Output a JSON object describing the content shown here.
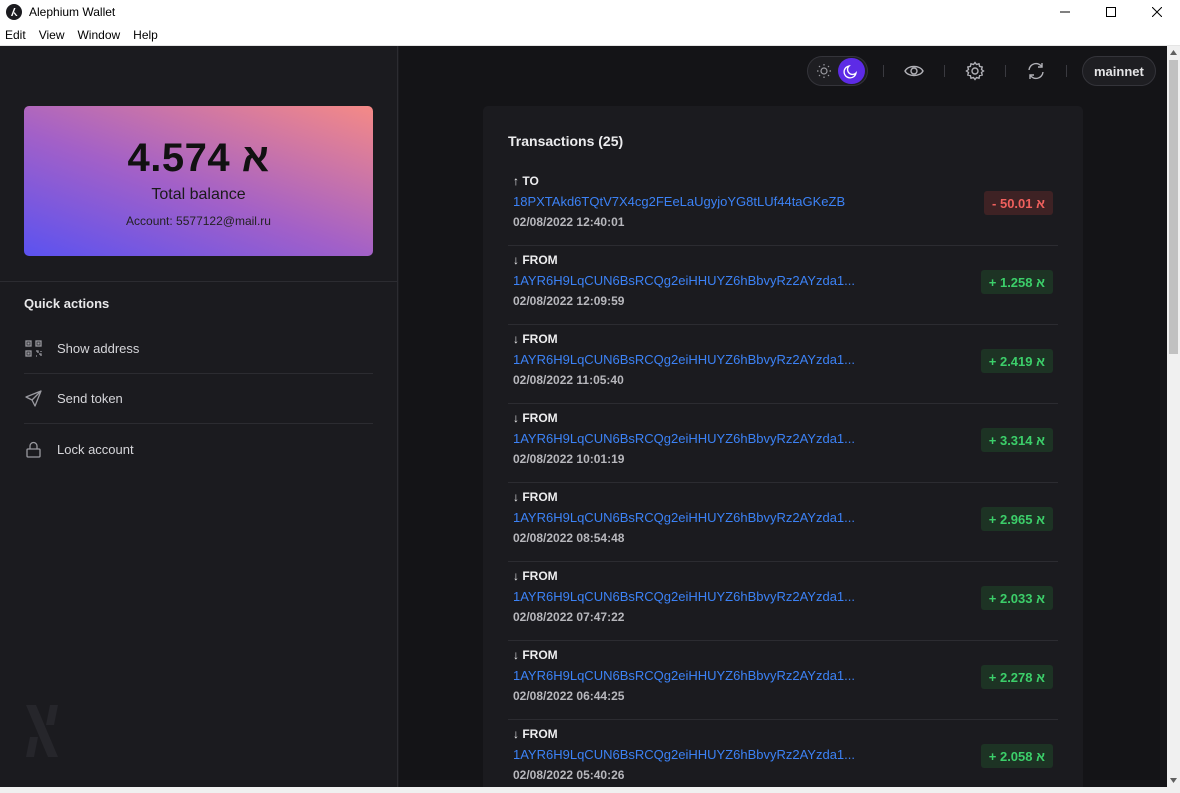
{
  "window": {
    "title": "Alephium Wallet"
  },
  "menu": [
    {
      "label": "Edit"
    },
    {
      "label": "View"
    },
    {
      "label": "Window"
    },
    {
      "label": "Help"
    }
  ],
  "balance": {
    "value": "4.574 א",
    "label": "Total balance",
    "account": "Account: 5577122@mail.ru"
  },
  "quick_actions": {
    "title": "Quick actions",
    "items": [
      {
        "label": "Show address",
        "icon": "qr-code-icon"
      },
      {
        "label": "Send token",
        "icon": "send-icon"
      },
      {
        "label": "Lock account",
        "icon": "lock-icon"
      }
    ]
  },
  "top_controls": {
    "theme_options": [
      "sun-icon",
      "moon-icon"
    ],
    "active_theme": "dark",
    "network": "mainnet"
  },
  "transactions": {
    "title": "Transactions (25)",
    "items": [
      {
        "direction": "↑ TO",
        "address": "18PXTAkd6TQtV7X4cg2FEeLaUgyjoYG8tLUf44taGKeZB",
        "date": "02/08/2022 12:40:01",
        "amount": "- 50.01 א",
        "type": "out"
      },
      {
        "direction": "↓ FROM",
        "address": "1AYR6H9LqCUN6BsRCQg2eiHHUYZ6hBbvyRz2AYzda1...",
        "date": "02/08/2022 12:09:59",
        "amount": "+ 1.258 א",
        "type": "in"
      },
      {
        "direction": "↓ FROM",
        "address": "1AYR6H9LqCUN6BsRCQg2eiHHUYZ6hBbvyRz2AYzda1...",
        "date": "02/08/2022 11:05:40",
        "amount": "+ 2.419 א",
        "type": "in"
      },
      {
        "direction": "↓ FROM",
        "address": "1AYR6H9LqCUN6BsRCQg2eiHHUYZ6hBbvyRz2AYzda1...",
        "date": "02/08/2022 10:01:19",
        "amount": "+ 3.314 א",
        "type": "in"
      },
      {
        "direction": "↓ FROM",
        "address": "1AYR6H9LqCUN6BsRCQg2eiHHUYZ6hBbvyRz2AYzda1...",
        "date": "02/08/2022 08:54:48",
        "amount": "+ 2.965 א",
        "type": "in"
      },
      {
        "direction": "↓ FROM",
        "address": "1AYR6H9LqCUN6BsRCQg2eiHHUYZ6hBbvyRz2AYzda1...",
        "date": "02/08/2022 07:47:22",
        "amount": "+ 2.033 א",
        "type": "in"
      },
      {
        "direction": "↓ FROM",
        "address": "1AYR6H9LqCUN6BsRCQg2eiHHUYZ6hBbvyRz2AYzda1...",
        "date": "02/08/2022 06:44:25",
        "amount": "+ 2.278 א",
        "type": "in"
      },
      {
        "direction": "↓ FROM",
        "address": "1AYR6H9LqCUN6BsRCQg2eiHHUYZ6hBbvyRz2AYzda1...",
        "date": "02/08/2022 05:40:26",
        "amount": "+ 2.058 א",
        "type": "in"
      }
    ]
  },
  "colors": {
    "accent": "#5d2be6",
    "link": "#3c82f6",
    "positive": "#3ccf6a",
    "negative": "#f0605d"
  }
}
